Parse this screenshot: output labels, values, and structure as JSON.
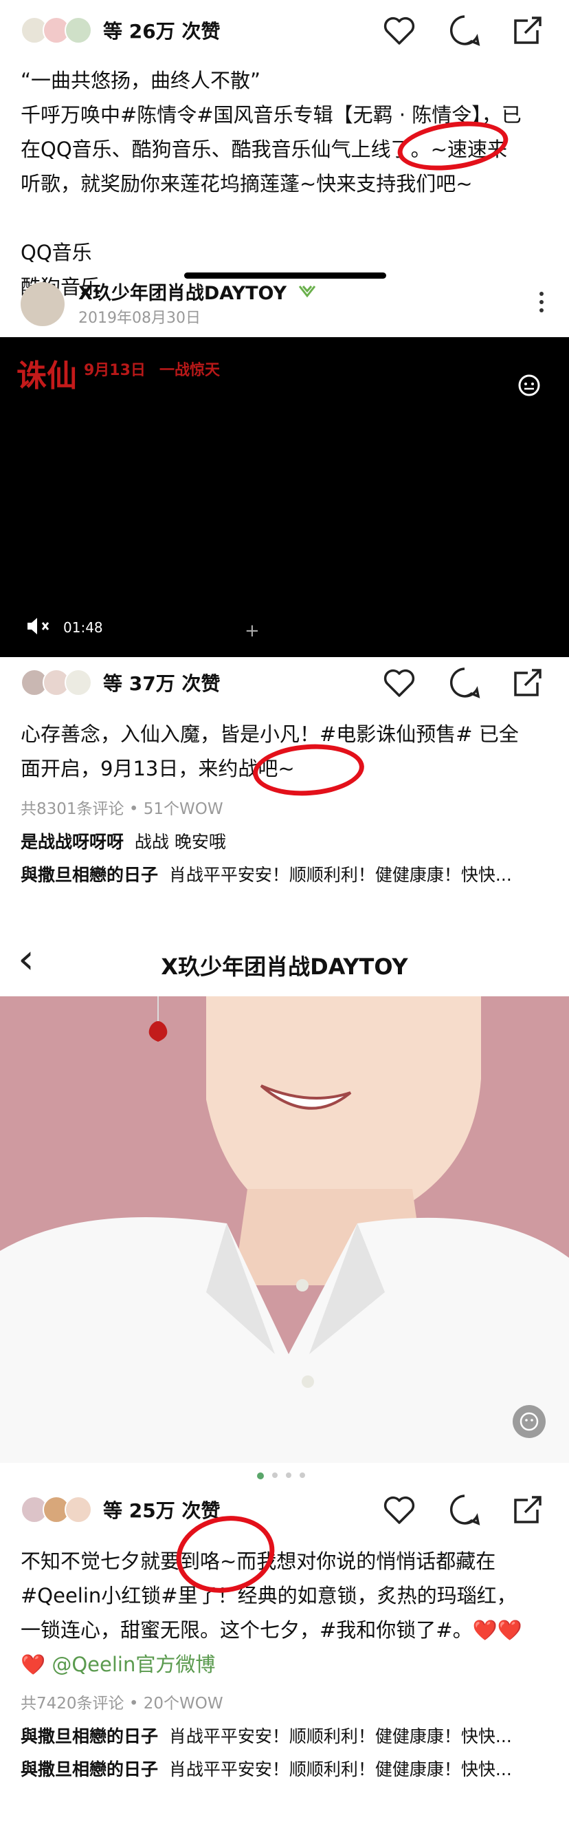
{
  "post1": {
    "likes": "等 26万 次赞",
    "lines": [
      "“一曲共悠扬，曲终人不散”",
      "千呼万唤中#陈情令#国风音乐专辑【无羁 · 陈情令】，已",
      "在QQ音乐、酷狗音乐、酷我音乐仙气上线了。~速速来",
      "听歌，就奖励你来莲花坞摘莲蓬~快来支持我们吧~",
      "",
      "QQ音乐",
      "酷狗音乐"
    ]
  },
  "post2_header": {
    "author": "X玖少年团肖战DAYTOY",
    "date": "2019年08月30日"
  },
  "video": {
    "logo_text": "诛仙",
    "release_text": "9月13日",
    "tagline": "一战惊天",
    "duration": "01:48",
    "mute_symbol": "✕"
  },
  "post2": {
    "likes": "等 37万 次赞",
    "lines": [
      "心存善念，入仙入魔，皆是小凡！#电影诛仙预售# 已全",
      "面开启，9月13日，来约战吧~"
    ],
    "meta": "共8301条评论 • 51个WOW",
    "comments": [
      {
        "user": "是战战呀呀呀",
        "text": "战战 晚安哦"
      },
      {
        "user": "與撒旦相戀的日子",
        "text": "肖战平平安安！顺顺利利！健健康康！快快..."
      }
    ]
  },
  "profile_header": {
    "back": "‹",
    "title": "X玖少年团肖战DAYTOY"
  },
  "post3": {
    "likes": "等 25万 次赞",
    "line1": "不知不觉七夕就要到咯~而我想对你说的悄悄话都藏在",
    "line2": "#Qeelin小红锁#里了！经典的如意锁，炙热的玛瑙红，",
    "line3": "一锁连心，甜蜜无限。这个七夕，#我和你锁了#。❤️❤️",
    "line4_heart": "❤️",
    "line4_mention": "@Qeelin官方微博",
    "meta": "共7420条评论 • 20个WOW",
    "comments": [
      {
        "user": "與撒旦相戀的日子",
        "text": "肖战平平安安！顺顺利利！健健康康！快快..."
      },
      {
        "user": "與撒旦相戀的日子",
        "text": "肖战平平安安！顺顺利利！健健康康！快快..."
      }
    ]
  },
  "colors": {
    "annotation_red": "#e3101a",
    "photo_bg": "#cf9aa0",
    "accent_green": "#5a9a4e"
  }
}
